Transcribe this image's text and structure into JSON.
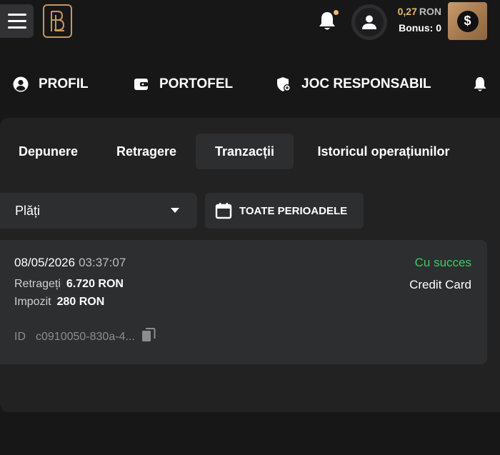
{
  "header": {
    "balance_amount": "0,27",
    "balance_currency": "RON",
    "bonus_label": "Bonus:",
    "bonus_value": "0",
    "deposit_icon_symbol": "$",
    "colors": {
      "accent": "#e8b673",
      "brand_gold": "#c7975a"
    }
  },
  "nav": {
    "items": [
      {
        "label": "PROFIL",
        "icon": "user-circle-icon"
      },
      {
        "label": "PORTOFEL",
        "icon": "wallet-icon"
      },
      {
        "label": "JOC RESPONSABIL",
        "icon": "shield-icon"
      },
      {
        "label": "",
        "icon": "bell-icon"
      }
    ]
  },
  "tabs": [
    {
      "label": "Depunere",
      "active": false
    },
    {
      "label": "Retragere",
      "active": false
    },
    {
      "label": "Tranzacții",
      "active": true
    },
    {
      "label": "Istoricul operațiunilor",
      "active": false
    }
  ],
  "filters": {
    "type_selected": "Plăți",
    "period_label": "TOATE PERIOADELE"
  },
  "transaction": {
    "date": "08/05/2026",
    "time": "03:37:07",
    "status": "Cu succes",
    "status_color": "#42c86a",
    "method": "Credit Card",
    "withdraw_label": "Retrageți",
    "withdraw_value": "6.720 RON",
    "tax_label": "Impozit",
    "tax_value": "280 RON",
    "id_label": "ID",
    "id_value": "c0910050-830a-4..."
  }
}
